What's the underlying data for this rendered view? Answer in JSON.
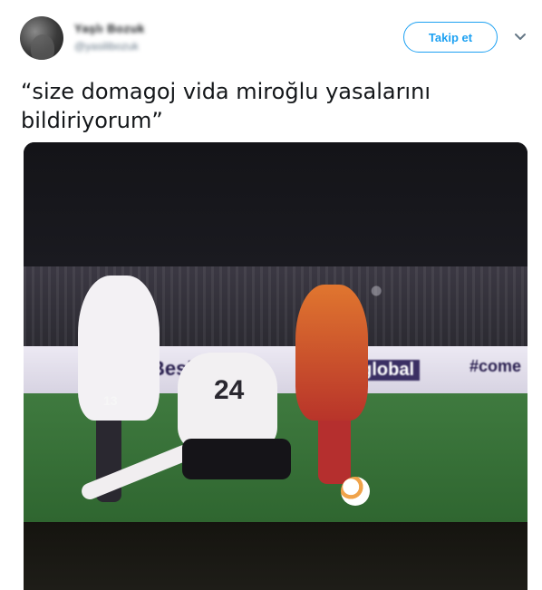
{
  "header": {
    "user_name": "Yaşlı Bozuk",
    "user_handle": "@yasilibozuk",
    "follow_label": "Takip et",
    "caret_icon": "chevron-down-icon"
  },
  "tweet": {
    "text": "“size domagoj vida miroğlu yasalarını bildiriyorum”"
  },
  "media": {
    "ad_board_left": "Beşi",
    "ad_board_mid": "kglobal",
    "ad_board_right": "#come",
    "jersey_numbers": [
      "13",
      "24"
    ]
  },
  "colors": {
    "accent": "#1da1f2",
    "text": "#14171a",
    "muted": "#657786"
  }
}
